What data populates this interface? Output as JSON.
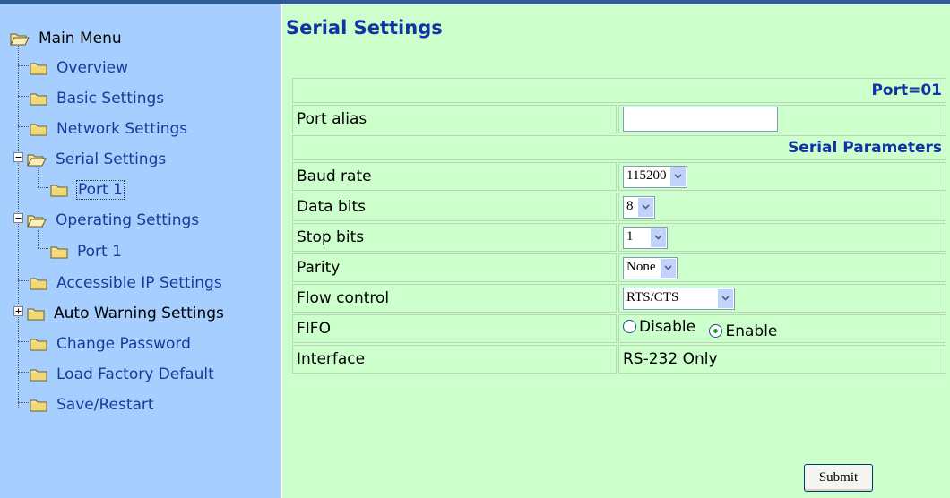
{
  "sidebar": {
    "root": "Main Menu",
    "items": [
      {
        "label": "Overview"
      },
      {
        "label": "Basic Settings"
      },
      {
        "label": "Network Settings"
      },
      {
        "label": "Serial Settings"
      },
      {
        "label": "Port 1"
      },
      {
        "label": "Operating Settings"
      },
      {
        "label": "Port 1"
      },
      {
        "label": "Accessible IP Settings"
      },
      {
        "label": "Auto Warning Settings"
      },
      {
        "label": "Change Password"
      },
      {
        "label": "Load Factory Default"
      },
      {
        "label": "Save/Restart"
      }
    ]
  },
  "main": {
    "title": "Serial Settings",
    "port_header": "Port=01",
    "port_alias": {
      "label": "Port alias",
      "value": ""
    },
    "serial_params_header": "Serial Parameters",
    "baud_rate": {
      "label": "Baud rate",
      "value": "115200"
    },
    "data_bits": {
      "label": "Data bits",
      "value": "8"
    },
    "stop_bits": {
      "label": "Stop bits",
      "value": "1"
    },
    "parity": {
      "label": "Parity",
      "value": "None"
    },
    "flow_control": {
      "label": "Flow control",
      "value": "RTS/CTS"
    },
    "fifo": {
      "label": "FIFO",
      "disable_label": "Disable",
      "enable_label": "Enable",
      "selected": "Enable"
    },
    "interface": {
      "label": "Interface",
      "value": "RS-232 Only"
    },
    "submit_label": "Submit"
  },
  "colors": {
    "sidebar_bg": "#a6cfff",
    "main_bg": "#ccffcc",
    "title": "#1233a3",
    "link": "#1a3a98"
  }
}
